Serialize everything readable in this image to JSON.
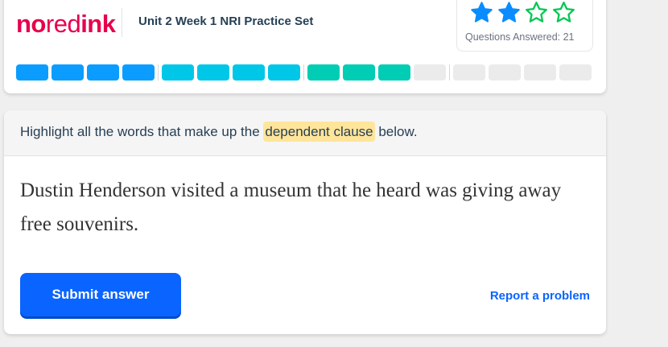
{
  "header": {
    "logo": {
      "part1": "no",
      "part2": "red",
      "part3": "ink"
    },
    "title": "Unit 2 Week 1 NRI Practice Set"
  },
  "stars": {
    "filled": 2,
    "total": 4,
    "label_text": "Questions Answered:",
    "answered_count": "21",
    "filled_color": "#0a8cff",
    "empty_color": "#00c853"
  },
  "progress": {
    "segments": [
      "#0a9dff",
      "#0a9dff",
      "#0a9dff",
      "#0a9dff",
      "sep",
      "#00c7e8",
      "#00c7e8",
      "#00c7e8",
      "#00c7e8",
      "sep",
      "#00cdb4",
      "#00cdb4",
      "#00cdb4",
      "#ebebeb",
      "sep",
      "#ebebeb",
      "#ebebeb",
      "#ebebeb",
      "#ebebeb"
    ]
  },
  "question": {
    "prompt_before": "Highlight all the words that make up the ",
    "prompt_highlight": "dependent clause",
    "prompt_after": " below.",
    "passage": "Dustin Henderson visited a museum that he heard was giving away free souvenirs."
  },
  "actions": {
    "submit_label": "Submit answer",
    "report_label": "Report a problem"
  }
}
